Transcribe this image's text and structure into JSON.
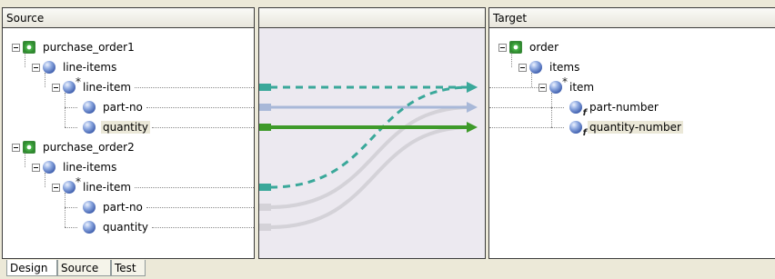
{
  "source": {
    "header": "Source",
    "nodes": [
      {
        "label": "purchase_order1",
        "icon": "root-element-icon",
        "level": 0,
        "expander": "−"
      },
      {
        "label": "line-items",
        "icon": "element-icon",
        "level": 1,
        "expander": "−"
      },
      {
        "label": "line-item",
        "icon": "repeating-element-icon",
        "level": 2,
        "expander": "−"
      },
      {
        "label": "part-no",
        "icon": "element-icon",
        "level": 3,
        "expander": ""
      },
      {
        "label": "quantity",
        "icon": "element-icon",
        "level": 3,
        "expander": "",
        "highlight": true
      },
      {
        "label": "purchase_order2",
        "icon": "root-element-icon",
        "level": 0,
        "expander": "−"
      },
      {
        "label": "line-items",
        "icon": "element-icon",
        "level": 1,
        "expander": "−"
      },
      {
        "label": "line-item",
        "icon": "repeating-element-icon",
        "level": 2,
        "expander": "−"
      },
      {
        "label": "part-no",
        "icon": "element-icon",
        "level": 3,
        "expander": ""
      },
      {
        "label": "quantity",
        "icon": "element-icon",
        "level": 3,
        "expander": ""
      }
    ]
  },
  "target": {
    "header": "Target",
    "nodes": [
      {
        "label": "order",
        "icon": "root-element-icon",
        "level": 0,
        "expander": "−"
      },
      {
        "label": "items",
        "icon": "element-icon",
        "level": 1,
        "expander": "−"
      },
      {
        "label": "item",
        "icon": "repeating-element-icon",
        "level": 2,
        "expander": "−"
      },
      {
        "label": "part-number",
        "icon": "function-element-icon",
        "level": 3,
        "expander": ""
      },
      {
        "label": "quantity-number",
        "icon": "function-element-icon",
        "level": 3,
        "expander": "",
        "highlight": true
      }
    ]
  },
  "mappings": [
    {
      "from": 2,
      "to": 2,
      "style": "dashed",
      "color": "#3aa89a"
    },
    {
      "from": 3,
      "to": 3,
      "style": "solid",
      "color": "#a8b8d8"
    },
    {
      "from": 4,
      "to": 4,
      "style": "solid-bold",
      "color": "#3e9a2a"
    },
    {
      "from": 7,
      "to": 2,
      "style": "dashed",
      "color": "#3aa89a"
    },
    {
      "from": 8,
      "to": 3,
      "style": "faint",
      "color": "#d4d2d8"
    },
    {
      "from": 9,
      "to": 4,
      "style": "faint",
      "color": "#d4d2d8"
    }
  ],
  "tabs": [
    {
      "label": "Design",
      "active": true
    },
    {
      "label": "Source",
      "active": false
    },
    {
      "label": "Test",
      "active": false
    }
  ]
}
